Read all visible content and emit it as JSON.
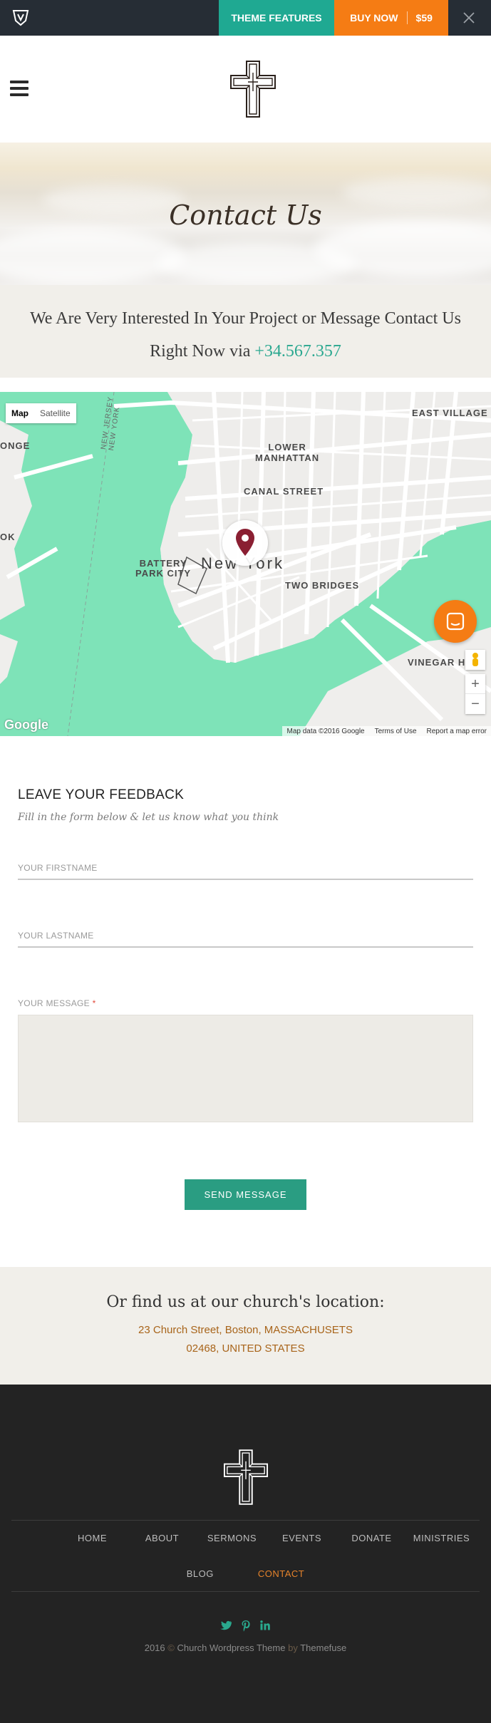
{
  "topbar": {
    "features_label": "THEME FEATURES",
    "buy_label": "BUY NOW",
    "price": "$59"
  },
  "hero": {
    "title": "Contact Us"
  },
  "intro": {
    "text": "We Are Very Interested In Your Project or Message Contact Us Right Now via",
    "phone": "+34.567.357"
  },
  "map": {
    "type_map": "Map",
    "type_satellite": "Satellite",
    "labels": {
      "east_village": "EAST VILLAGE",
      "lower_manhattan": "LOWER\nMANHATTAN",
      "canal_street": "CANAL STREET",
      "new_york": "New York",
      "battery_park": "BATTERY\nPARK CITY",
      "two_bridges": "TWO BRIDGES",
      "vinegar_hill": "VINEGAR H",
      "new_jersey": "NEW JERSEY\nNEW YORK",
      "onge": "ONGE",
      "ok": "OK"
    },
    "footer": {
      "data": "Map data ©2016 Google",
      "terms": "Terms of Use",
      "report": "Report a map error"
    },
    "logo": "Google"
  },
  "form": {
    "title": "LEAVE YOUR FEEDBACK",
    "subtitle": "Fill in the form below & let us know what you think",
    "firstname_placeholder": "YOUR FIRSTNAME",
    "lastname_placeholder": "YOUR LASTNAME",
    "message_label": "YOUR MESSAGE",
    "required_mark": "*",
    "send_label": "SEND MESSAGE"
  },
  "location": {
    "title": "Or find us at our church's location:",
    "line1": "23 Church Street, Boston, MASSACHUSETS",
    "line2": "02468, UNITED STATES"
  },
  "footer": {
    "nav_row1": [
      "HOME",
      "ABOUT",
      "SERMONS",
      "EVENTS",
      "DONATE",
      "MINISTRIES"
    ],
    "nav_row2": [
      "BLOG",
      "CONTACT"
    ],
    "active": "CONTACT",
    "copyright_year": "2016",
    "copyright_symbol": "©",
    "copyright_site": "Church Wordpress Theme",
    "copyright_by": "by",
    "copyright_author": "Themefuse"
  },
  "colors": {
    "accent_green": "#1fa992",
    "accent_orange": "#f57c14",
    "link_brown": "#a8641a"
  }
}
